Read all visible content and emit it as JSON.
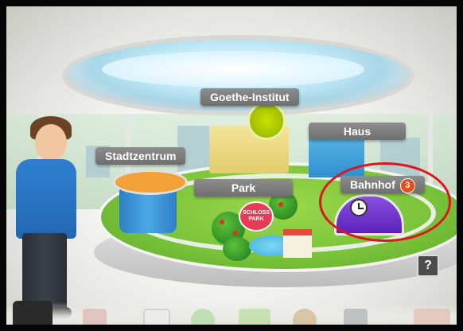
{
  "locations": {
    "goethe": "Goethe-Institut",
    "haus": "Haus",
    "stadtzentrum": "Stadtzentrum",
    "park": "Park",
    "bahnhof": "Bahnhof",
    "bahnhof_badge": "3"
  },
  "park_sign": "SCHLOSS PARK",
  "help_label": "?",
  "colors": {
    "label_bg": "#7d7d7d",
    "badge": "#e84d1c",
    "highlight_ring": "#e0141e",
    "island_green": "#7bc43a"
  },
  "toolbar_icons": [
    "notebook-icon",
    "phone-icon",
    "chat-bubble-icon",
    "board-icon",
    "person-icon",
    "desk-icon",
    "people-icon"
  ]
}
